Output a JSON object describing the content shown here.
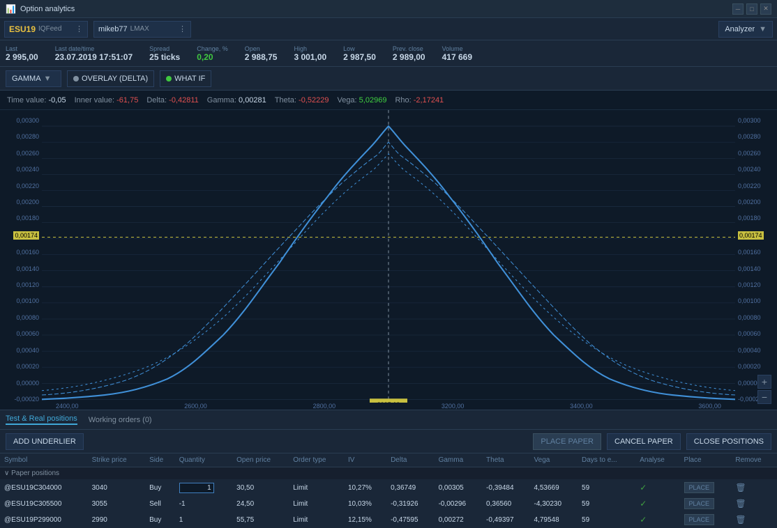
{
  "titleBar": {
    "title": "Option analytics",
    "icon": "📊",
    "controls": [
      "─",
      "□",
      "✕"
    ]
  },
  "instrumentBar": {
    "instrument": "ESU19",
    "source": "IQFeed",
    "account": "mikeb77",
    "accountSource": "LMAX",
    "analyzerLabel": "Analyzer"
  },
  "stats": [
    {
      "label": "Last",
      "value": "2 995,00"
    },
    {
      "label": "Last date/time",
      "value": "23.07.2019 17:51:07"
    },
    {
      "label": "Spread",
      "value": "25 ticks"
    },
    {
      "label": "Change, %",
      "value": "0,20",
      "type": "up"
    },
    {
      "label": "Open",
      "value": "2 988,75"
    },
    {
      "label": "High",
      "value": "3 001,00"
    },
    {
      "label": "Low",
      "value": "2 987,50"
    },
    {
      "label": "Prev. close",
      "value": "2 989,00"
    },
    {
      "label": "Volume",
      "value": "417 669"
    }
  ],
  "controls": {
    "gammaLabel": "GAMMA",
    "overlayLabel": "OVERLAY (DELTA)",
    "whatIfLabel": "WHAT IF"
  },
  "greeks": {
    "timeValue": {
      "label": "Time value:",
      "value": "-0,05",
      "type": "negative"
    },
    "innerValue": {
      "label": "Inner value:",
      "value": "-61,75",
      "type": "negative"
    },
    "delta": {
      "label": "Delta:",
      "value": "-0,42811",
      "type": "negative"
    },
    "gamma": {
      "label": "Gamma:",
      "value": "0,00281",
      "type": "neutral"
    },
    "theta": {
      "label": "Theta:",
      "value": "-0,52229",
      "type": "red"
    },
    "vega": {
      "label": "Vega:",
      "value": "5,02969",
      "type": "green"
    },
    "rho": {
      "label": "Rho:",
      "value": "-2,17241",
      "type": "negative"
    }
  },
  "chart": {
    "yAxisLabels": [
      "0,00300",
      "0,00280",
      "0,00260",
      "0,00240",
      "0,00220",
      "0,00200",
      "0,00180",
      "0,00160",
      "0,00140",
      "0,00120",
      "0,00100",
      "0,00080",
      "0,00060",
      "0,00040",
      "0,00020",
      "0,00000",
      "-0,00020"
    ],
    "xAxisLabels": [
      "2400,00",
      "2600,00",
      "2800,00",
      "3200,00",
      "3400,00",
      "3600,00"
    ],
    "currentPrice": "2995,13",
    "yMarker": "0,00174"
  },
  "bottomPanel": {
    "tabs": [
      {
        "label": "Test & Real positions",
        "active": true
      },
      {
        "label": "Working orders (0)",
        "active": false
      }
    ],
    "buttons": {
      "addUnderlier": "ADD UNDERLIER",
      "placePaper": "PLACE PAPER",
      "cancelPaper": "CANCEL PAPER",
      "closePositions": "CLOSE POSITIONS"
    },
    "tableHeaders": [
      "Symbol",
      "Strike price",
      "Side",
      "Quantity",
      "Open price",
      "Order type",
      "IV",
      "Delta",
      "Gamma",
      "Theta",
      "Vega",
      "Days to e...",
      "Analyse",
      "Place",
      "Remove"
    ],
    "sections": [
      {
        "name": "Paper positions",
        "rows": [
          {
            "symbol": "@ESU19C304000",
            "strikePrice": "3040",
            "side": "Buy",
            "quantity": "1",
            "openPrice": "30,50",
            "orderType": "Limit",
            "iv": "10,27%",
            "delta": "0,36749",
            "gamma": "0,00305",
            "theta": "-0,39484",
            "vega": "4,53669",
            "daysToExp": "59",
            "hasCheck": true
          },
          {
            "symbol": "@ESU19C305500",
            "strikePrice": "3055",
            "side": "Sell",
            "quantity": "-1",
            "openPrice": "24,50",
            "orderType": "Limit",
            "iv": "10,03%",
            "delta": "-0,31926",
            "gamma": "-0,00296",
            "theta": "0,36560",
            "vega": "-4,30230",
            "daysToExp": "59",
            "hasCheck": true
          },
          {
            "symbol": "@ESU19P299000",
            "strikePrice": "2990",
            "side": "Buy",
            "quantity": "1",
            "openPrice": "55,75",
            "orderType": "Limit",
            "iv": "12,15%",
            "delta": "-0,47595",
            "gamma": "0,00272",
            "theta": "-0,49397",
            "vega": "4,79548",
            "daysToExp": "59",
            "hasCheck": true
          }
        ]
      }
    ]
  }
}
